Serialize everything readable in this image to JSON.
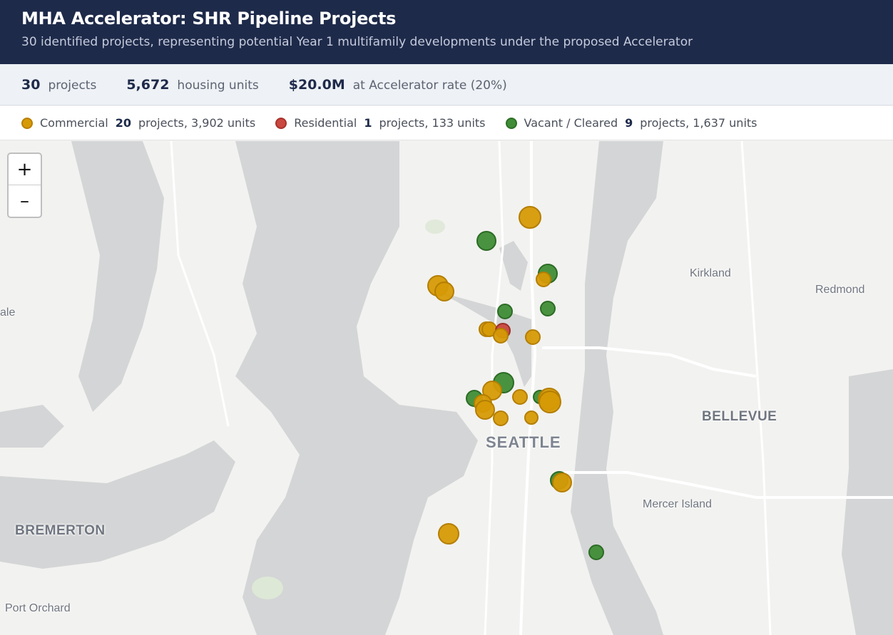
{
  "header": {
    "title": "MHA Accelerator: SHR Pipeline Projects",
    "subtitle": "30 identified projects, representing potential Year 1 multifamily developments under the proposed Accelerator"
  },
  "stats": {
    "projects_value": "30",
    "projects_label": "projects",
    "units_value": "5,672",
    "units_label": "housing units",
    "money_value": "$20.0M",
    "money_label": "at Accelerator rate (20%)"
  },
  "legend": [
    {
      "category": "Commercial",
      "count": "20",
      "detail": "projects, 3,902 units",
      "color": "#d69a06",
      "border": "#b97f00"
    },
    {
      "category": "Residential",
      "count": "1",
      "detail": "projects, 133 units",
      "color": "#c9483f",
      "border": "#a8322b"
    },
    {
      "category": "Vacant / Cleared",
      "count": "9",
      "detail": "projects, 1,637 units",
      "color": "#3f8d36",
      "border": "#2e6f27"
    }
  ],
  "zoom": {
    "in_label": "+",
    "out_label": "–"
  },
  "places": {
    "kirkland": "Kirkland",
    "redmond": "Redmond",
    "bellevue": "BELLEVUE",
    "seattle": "SEATTLE",
    "mercer_island": "Mercer Island",
    "bremerton": "BREMERTON",
    "port_orchard": "Port Orchard",
    "left_edge": "ale"
  },
  "colors": {
    "header_bg": "#1e2a4a",
    "water": "#d4d5d6",
    "land": "#f2f2f0",
    "commercial": "#d69a06",
    "residential": "#c9483f",
    "vacant": "#3f8d36"
  }
}
